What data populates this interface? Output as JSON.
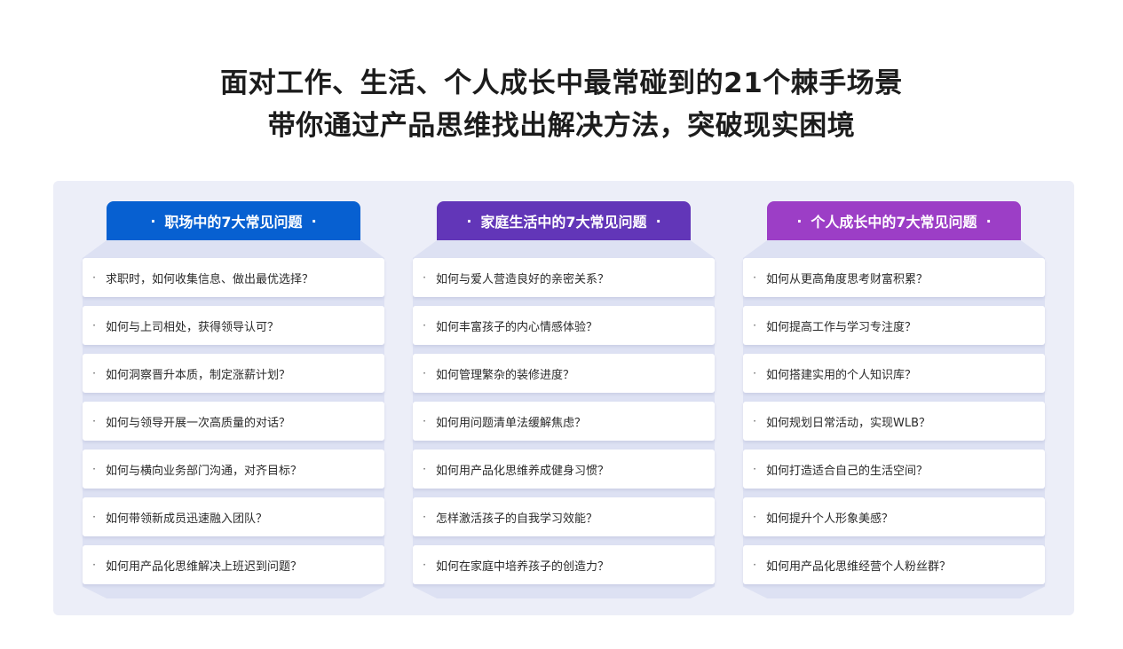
{
  "headline": {
    "line1": "面对工作、生活、个人成长中最常碰到的21个棘手场景",
    "line2": "带你通过产品思维找出解决方法，突破现实困境"
  },
  "colors": {
    "career": "#0760d1",
    "family": "#6236b8",
    "growth": "#9c3ec6",
    "panel": "#eceef8"
  },
  "columns": [
    {
      "title": "职场中的7大常见问题",
      "items": [
        "求职时，如何收集信息、做出最优选择？",
        "如何与上司相处，获得领导认可？",
        "如何洞察晋升本质，制定涨薪计划？",
        "如何与领导开展一次高质量的对话？",
        "如何与横向业务部门沟通，对齐目标？",
        "如何带领新成员迅速融入团队？",
        "如何用产品化思维解决上班迟到问题？"
      ]
    },
    {
      "title": "家庭生活中的7大常见问题",
      "items": [
        "如何与爱人营造良好的亲密关系？",
        "如何丰富孩子的内心情感体验？",
        "如何管理繁杂的装修进度？",
        "如何用问题清单法缓解焦虑？",
        "如何用产品化思维养成健身习惯？",
        "怎样激活孩子的自我学习效能？",
        "如何在家庭中培养孩子的创造力？"
      ]
    },
    {
      "title": "个人成长中的7大常见问题",
      "items": [
        "如何从更高角度思考财富积累？",
        "如何提高工作与学习专注度？",
        "如何搭建实用的个人知识库？",
        "如何规划日常活动，实现WLB？",
        "如何打造适合自己的生活空间？",
        "如何提升个人形象美感？",
        "如何用产品化思维经营个人粉丝群？"
      ]
    }
  ]
}
